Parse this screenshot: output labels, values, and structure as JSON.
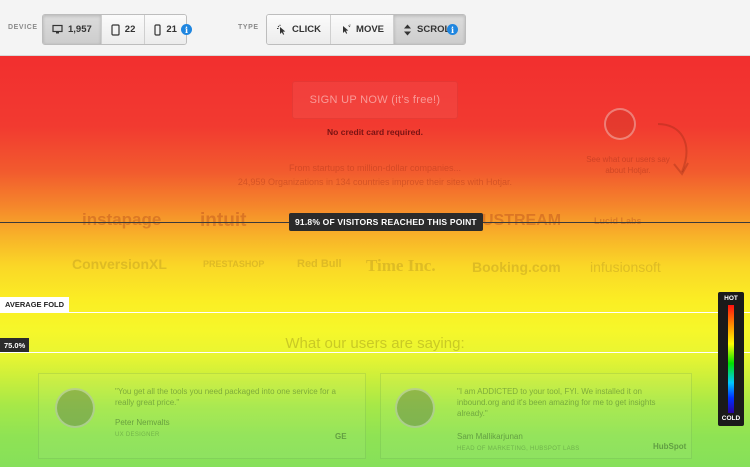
{
  "toolbar": {
    "device_label": "DEVICE",
    "devices": [
      {
        "icon": "desktop-icon",
        "count": "1,957",
        "active": true
      },
      {
        "icon": "tablet-icon",
        "count": "22",
        "active": false
      },
      {
        "icon": "phone-icon",
        "count": "21",
        "active": false
      }
    ],
    "type_label": "TYPE",
    "types": [
      {
        "icon": "click-icon",
        "label": "CLICK",
        "active": false
      },
      {
        "icon": "move-icon",
        "label": "MOVE",
        "active": false
      },
      {
        "icon": "scroll-icon",
        "label": "SCROLL",
        "active": true
      }
    ],
    "info_icon": "info-icon"
  },
  "page": {
    "signup_label": "SIGN UP NOW (it's free!)",
    "no_credit_card": "No credit card required.",
    "tagline_line1": "From startups to million-dollar companies...",
    "tagline_line2": "24,959 Organizations in 134 countries improve their sites with Hotjar.",
    "see_users": "See what our users say about Hotjar.",
    "logos_row1": [
      "instapage",
      "intuit",
      "USTREAM",
      "Lucid Labs"
    ],
    "logos_row2": [
      "ConversionXL",
      "PRESTASHOP",
      "Red Bull",
      "Time Inc.",
      "Booking.com",
      "infusionsoft"
    ],
    "section_title": "What our users are saying:",
    "testimonials": [
      {
        "quote": "\"You get all the tools you need packaged into one service for a really great price.\"",
        "name": "Peter Nemvalts",
        "role": "UX DESIGNER",
        "company": "GE"
      },
      {
        "quote": "\"I am ADDICTED to your tool, FYI. We installed it on inbound.org and it's been amazing for me to get insights already.\"",
        "name": "Sam Mallikarjunan",
        "role": "HEAD OF MARKETING, HUBSPOT LABS",
        "company": "HubSpot"
      }
    ]
  },
  "overlay": {
    "reach_text": "91.8% OF VISITORS REACHED THIS POINT",
    "average_fold": "AVERAGE FOLD",
    "percent_marker": "75.0%",
    "legend_hot": "HOT",
    "legend_cold": "COLD"
  },
  "colors": {
    "hot": "#f22f2f",
    "warm": "#fbee24",
    "cool": "#86e05a",
    "info": "#1f86e0"
  }
}
